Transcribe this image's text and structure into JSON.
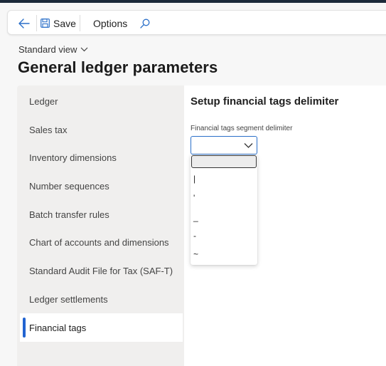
{
  "toolbar": {
    "save_label": "Save",
    "options_label": "Options"
  },
  "view_selector": {
    "label": "Standard view"
  },
  "page": {
    "title": "General ledger parameters"
  },
  "nav": {
    "items": [
      {
        "label": "Ledger"
      },
      {
        "label": "Sales tax"
      },
      {
        "label": "Inventory dimensions"
      },
      {
        "label": "Number sequences"
      },
      {
        "label": "Batch transfer rules"
      },
      {
        "label": "Chart of accounts and dimensions"
      },
      {
        "label": "Standard Audit File for Tax (SAF-T)"
      },
      {
        "label": "Ledger settlements"
      },
      {
        "label": "Financial tags"
      }
    ],
    "selected": "Financial tags"
  },
  "section": {
    "title": "Setup financial tags delimiter",
    "field_label": "Financial tags segment delimiter",
    "current_value": ""
  },
  "dropdown": {
    "options": [
      "",
      "|",
      "'",
      "_",
      "-",
      "~"
    ]
  },
  "colors": {
    "accent": "#2264d1",
    "combo_border": "#2a6fc9",
    "nav_background": "#f0efee",
    "page_background": "#f7f7f7"
  }
}
